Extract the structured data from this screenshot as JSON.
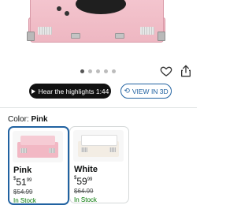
{
  "product": {
    "image_alt": "pink suitcase record player",
    "carousel": {
      "total": 5,
      "active": 0
    }
  },
  "actions": {
    "highlights_label": "Hear the highlights 1:44",
    "view3d_label": "VIEW IN 3D"
  },
  "icons": {
    "wishlist": "heart-icon",
    "share": "share-icon",
    "play": "play-icon",
    "view3d": "cube-rotate-icon"
  },
  "color_selector": {
    "label": "Color:",
    "selected": "Pink",
    "options": [
      {
        "name": "Pink",
        "price_currency": "$",
        "price_whole": "51",
        "price_fraction": "99",
        "list_price": "$54.99",
        "stock": "In Stock",
        "selected": true
      },
      {
        "name": "White",
        "price_currency": "$",
        "price_whole": "59",
        "price_fraction": "99",
        "list_price": "$64.99",
        "stock": "In Stock",
        "selected": false
      }
    ]
  },
  "colors": {
    "accent": "#2162a1",
    "dark_button": "#111111",
    "turntable_pink": "#f4c6cf",
    "in_stock": "#007600"
  }
}
